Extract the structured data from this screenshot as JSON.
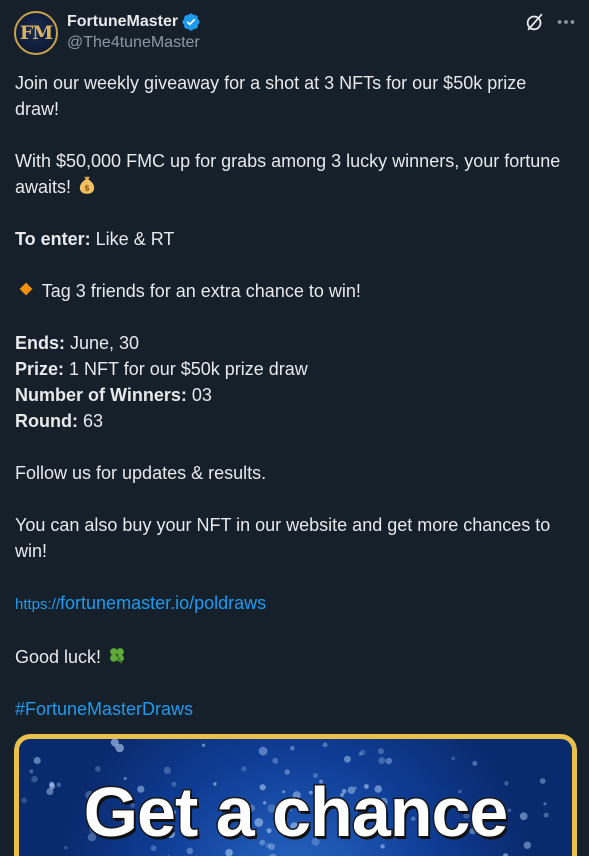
{
  "author": {
    "avatar_initials": "FM",
    "display_name": "FortuneMaster",
    "handle": "@The4tuneMaster",
    "verified": true
  },
  "header_icons": [
    "grok-icon",
    "more-icon"
  ],
  "tweet": {
    "p1": "Join our weekly giveaway for a shot at 3 NFTs for our $50k prize draw!",
    "p2": "With $50,000 FMC up for grabs among 3 lucky winners, your fortune awaits!",
    "p2_emoji": "money-bag-icon",
    "enter_label": "To enter:",
    "enter_value": " Like & RT",
    "tag_line": "Tag 3 friends for an extra chance to win!",
    "tag_emoji": "orange-diamond-icon",
    "ends_label": "Ends:",
    "ends_value": " June, 30",
    "prize_label": "Prize:",
    "prize_value": " 1 NFT for our $50k prize draw",
    "winners_label": "Number of Winners:",
    "winners_value": " 03",
    "round_label": "Round:",
    "round_value": " 63",
    "follow_line": "Follow us for updates & results.",
    "buy_line": "You can also buy your NFT in our website and get more chances to win!",
    "link_proto": "https://",
    "link_text": "fortunemaster.io/poldraws",
    "good_luck": "Good luck!",
    "good_luck_emoji": "four-leaf-clover-icon",
    "hashtag": "#FortuneMasterDraws"
  },
  "media": {
    "headline": "Get a chance"
  },
  "colors": {
    "background": "#15202b",
    "text": "#e7e9ea",
    "secondary": "#8b98a5",
    "link": "#1d9bf0",
    "media_border": "#e8c04a",
    "media_bg": "#0a2c73"
  }
}
